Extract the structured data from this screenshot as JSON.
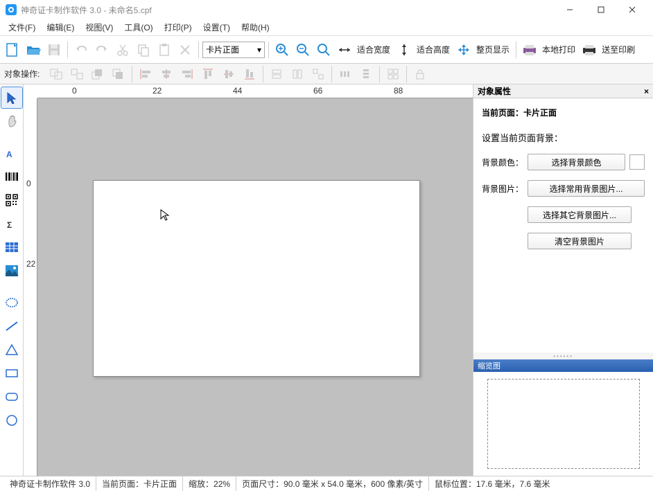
{
  "title": "神奇证卡制作软件 3.0 - 未命名5.cpf",
  "menu": {
    "file": "文件(F)",
    "edit": "编辑(E)",
    "view": "视图(V)",
    "tools": "工具(O)",
    "print": "打印(P)",
    "settings": "设置(T)",
    "help": "帮助(H)"
  },
  "toolbar": {
    "page_selector": "卡片正面",
    "fit_width": "适合宽度",
    "fit_height": "适合高度",
    "full_page": "整页显示",
    "local_print": "本地打印",
    "send_print": "送至印刷"
  },
  "obj_toolbar_label": "对象操作:",
  "ruler_h": [
    "0",
    "22",
    "44",
    "66",
    "88"
  ],
  "ruler_v": [
    "0",
    "22"
  ],
  "right_panel": {
    "header": "对象属性",
    "current_page_label": "当前页面：",
    "current_page_value": "卡片正面",
    "set_bg_label": "设置当前页面背景：",
    "bg_color_label": "背景颜色：",
    "bg_color_btn": "选择背景颜色",
    "bg_image_label": "背景图片：",
    "bg_image_btn1": "选择常用背景图片...",
    "bg_image_btn2": "选择其它背景图片...",
    "bg_clear_btn": "清空背景图片",
    "thumb_header": "缩览图"
  },
  "statusbar": {
    "app": "神奇证卡制作软件 3.0",
    "page": "当前页面：卡片正面",
    "zoom": "缩放：22%",
    "size": "页面尺寸：90.0 毫米 x 54.0 毫米，600 像素/英寸",
    "mouse": "鼠标位置：17.6 毫米，7.6 毫米"
  }
}
